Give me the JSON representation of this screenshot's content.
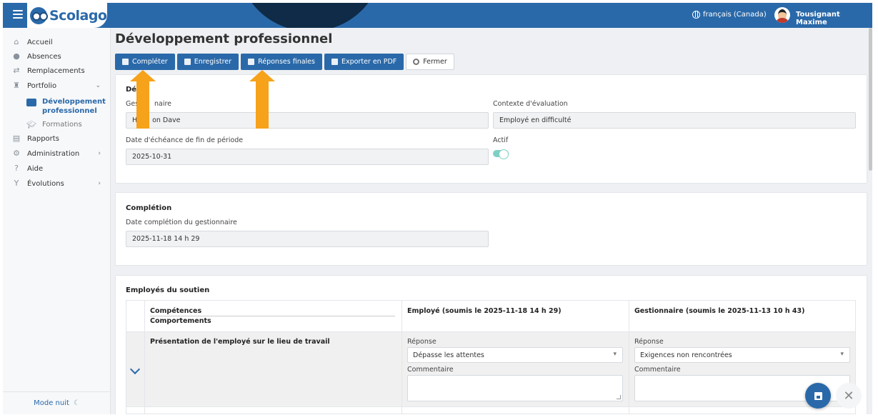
{
  "app": {
    "logo": "Scolago"
  },
  "header": {
    "language": "français (Canada)",
    "user": "Tousignant Maxime"
  },
  "sidebar": {
    "items": [
      {
        "label": "Accueil",
        "icon": "home-icon"
      },
      {
        "label": "Absences",
        "icon": "users-icon"
      },
      {
        "label": "Remplacements",
        "icon": "swap-icon"
      },
      {
        "label": "Portfolio",
        "icon": "trophy-icon",
        "chevron": "⌄"
      },
      {
        "label": "Rapports",
        "icon": "report-icon"
      },
      {
        "label": "Administration",
        "icon": "gear-icon",
        "chevron": "›"
      },
      {
        "label": "Aide",
        "icon": "help-icon"
      },
      {
        "label": "Évolutions",
        "icon": "plant-icon",
        "chevron": "›"
      }
    ],
    "sub": [
      {
        "label_line1": "Développement",
        "label_line2": "professionnel"
      },
      {
        "label": "Formations"
      }
    ],
    "mode_nuit": "Mode nuit"
  },
  "page": {
    "title": "Développement professionnel"
  },
  "toolbar": {
    "complete": "Compléter",
    "save": "Enregistrer",
    "final": "Réponses finales",
    "export": "Exporter en PDF",
    "close": "Fermer"
  },
  "details": {
    "title": "Dét",
    "manager_label": "Gest      naire",
    "manager_value": "Ha     on Dave",
    "context_label": "Contexte d'évaluation",
    "context_value": "Employé en difficulté",
    "due_label": "Date d'échéance de fin de période",
    "due_value": "2025-10-31",
    "active_label": "Actif"
  },
  "completion": {
    "title": "Complétion",
    "date_label": "Date complétion du gestionnaire",
    "date_value": "2025-11-18 14 h 29"
  },
  "support": {
    "title": "Employés du soutien",
    "col_competences": "Compétences",
    "col_comportements": "Comportements",
    "col_employee": "Employé (soumis le 2025-11-18 14 h 29)",
    "col_manager": "Gestionnaire (soumis le 2025-11-13 10 h 43)",
    "row": {
      "title": "Présentation de l'employé sur le lieu de travail",
      "response_label": "Réponse",
      "comment_label": "Commentaire",
      "employee_response": "Dépasse les attentes",
      "manager_response": "Exigences non rencontrées"
    }
  },
  "colors": {
    "primary": "#2a69a9",
    "accent_arrow": "#f6a21b",
    "toggle": "#7fd0c4"
  }
}
